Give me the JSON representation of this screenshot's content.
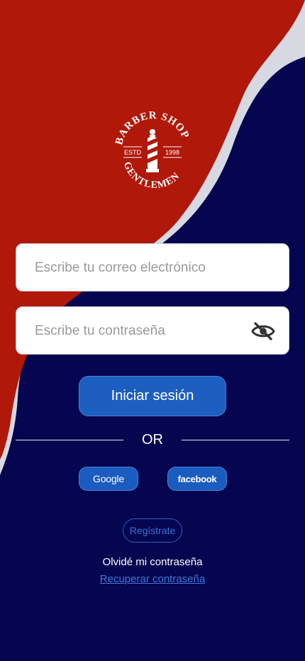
{
  "colors": {
    "red": "#B0180A",
    "navy": "#050550",
    "accent": "#1C5FC0"
  },
  "logo": {
    "top_text": "BARBER SHOP",
    "bottom_text": "GENTLEMEN",
    "estd_label": "ESTD",
    "year": "1998",
    "icon": "barber-pole-icon"
  },
  "form": {
    "email_placeholder": "Escribe tu correo electrónico",
    "email_value": "",
    "password_placeholder": "Escribe tu contraseña",
    "password_value": "",
    "password_toggle_icon": "eye-off-icon"
  },
  "login_label": "Iniciar sesión",
  "divider_label": "OR",
  "social": {
    "google_label": "Google",
    "facebook_label": "facebook"
  },
  "register_label": "Regístrate",
  "forgot_text": "Olvidé mi contraseña",
  "recover_link": "Recuperar contraseña"
}
